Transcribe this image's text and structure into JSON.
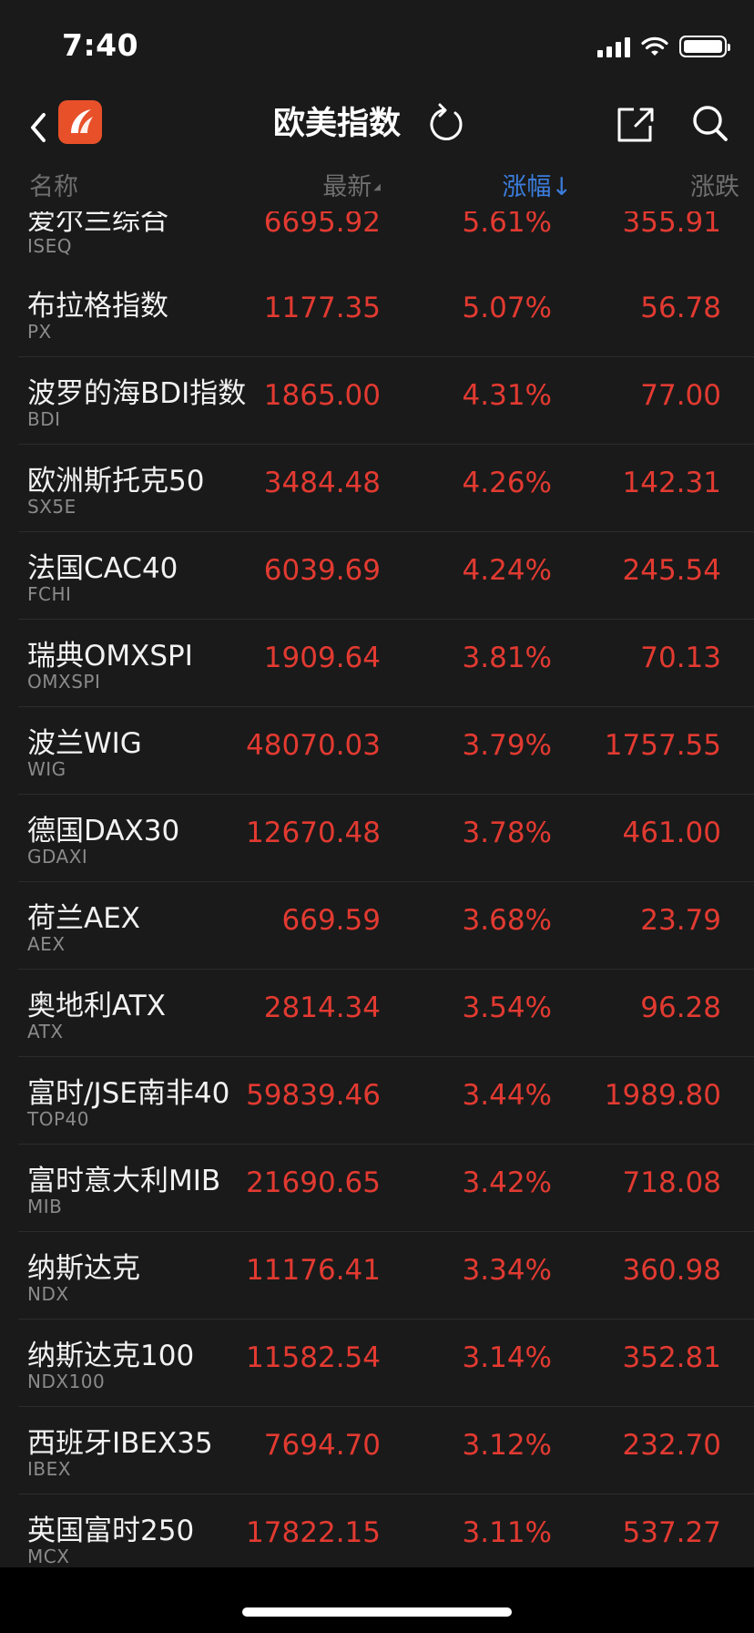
{
  "status": {
    "time": "7:40"
  },
  "nav": {
    "title": "欧美指数"
  },
  "columns": {
    "name": "名称",
    "latest": "最新",
    "change_pct": "涨幅↓",
    "change": "涨跌"
  },
  "rows": [
    {
      "name": "爱尔兰综合",
      "code": "ISEQ",
      "latest": "6695.92",
      "pct": "5.61%",
      "chg": "355.91"
    },
    {
      "name": "布拉格指数",
      "code": "PX",
      "latest": "1177.35",
      "pct": "5.07%",
      "chg": "56.78"
    },
    {
      "name": "波罗的海BDI指数",
      "code": "BDI",
      "latest": "1865.00",
      "pct": "4.31%",
      "chg": "77.00"
    },
    {
      "name": "欧洲斯托克50",
      "code": "SX5E",
      "latest": "3484.48",
      "pct": "4.26%",
      "chg": "142.31"
    },
    {
      "name": "法国CAC40",
      "code": "FCHI",
      "latest": "6039.69",
      "pct": "4.24%",
      "chg": "245.54"
    },
    {
      "name": "瑞典OMXSPI",
      "code": "OMXSPI",
      "latest": "1909.64",
      "pct": "3.81%",
      "chg": "70.13"
    },
    {
      "name": "波兰WIG",
      "code": "WIG",
      "latest": "48070.03",
      "pct": "3.79%",
      "chg": "1757.55"
    },
    {
      "name": "德国DAX30",
      "code": "GDAXI",
      "latest": "12670.48",
      "pct": "3.78%",
      "chg": "461.00"
    },
    {
      "name": "荷兰AEX",
      "code": "AEX",
      "latest": "669.59",
      "pct": "3.68%",
      "chg": "23.79"
    },
    {
      "name": "奥地利ATX",
      "code": "ATX",
      "latest": "2814.34",
      "pct": "3.54%",
      "chg": "96.28"
    },
    {
      "name": "富时/JSE南非40",
      "code": "TOP40",
      "latest": "59839.46",
      "pct": "3.44%",
      "chg": "1989.80"
    },
    {
      "name": "富时意大利MIB",
      "code": "MIB",
      "latest": "21690.65",
      "pct": "3.42%",
      "chg": "718.08"
    },
    {
      "name": "纳斯达克",
      "code": "NDX",
      "latest": "11176.41",
      "pct": "3.34%",
      "chg": "360.98"
    },
    {
      "name": "纳斯达克100",
      "code": "NDX100",
      "latest": "11582.54",
      "pct": "3.14%",
      "chg": "352.81"
    },
    {
      "name": "西班牙IBEX35",
      "code": "IBEX",
      "latest": "7694.70",
      "pct": "3.12%",
      "chg": "232.70"
    },
    {
      "name": "英国富时250",
      "code": "MCX",
      "latest": "17822.15",
      "pct": "3.11%",
      "chg": "537.27"
    }
  ],
  "colors": {
    "up": "#e23a31",
    "accent": "#3b7ddd",
    "logo": "#e8502a"
  }
}
